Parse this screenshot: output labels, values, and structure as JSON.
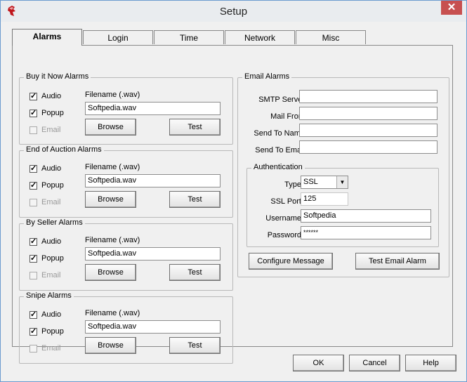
{
  "window": {
    "title": "Setup",
    "close_glyph": "✕"
  },
  "tabs": [
    {
      "label": "Alarms",
      "active": true
    },
    {
      "label": "Login"
    },
    {
      "label": "Time"
    },
    {
      "label": "Network"
    },
    {
      "label": "Misc"
    }
  ],
  "alarm_groups": [
    {
      "title": "Buy it Now Alarms",
      "audio": "Audio",
      "popup": "Popup",
      "email": "Email",
      "filename_label": "Filename (.wav)",
      "filename": "Softpedia.wav",
      "browse": "Browse",
      "test": "Test"
    },
    {
      "title": "End of Auction Alarms",
      "audio": "Audio",
      "popup": "Popup",
      "email": "Email",
      "filename_label": "Filename (.wav)",
      "filename": "Softpedia.wav",
      "browse": "Browse",
      "test": "Test"
    },
    {
      "title": "By Seller Alarms",
      "audio": "Audio",
      "popup": "Popup",
      "email": "Email",
      "filename_label": "Filename (.wav)",
      "filename": "Softpedia.wav",
      "browse": "Browse",
      "test": "Test"
    },
    {
      "title": "Snipe Alarms",
      "audio": "Audio",
      "popup": "Popup",
      "email": "Email",
      "filename_label": "Filename (.wav)",
      "filename": "Softpedia.wav",
      "browse": "Browse",
      "test": "Test"
    }
  ],
  "check_glyph": "✓",
  "email_alarms": {
    "title": "Email Alarms",
    "smtp_server_label": "SMTP Server",
    "smtp_server": "",
    "mail_from_label": "Mail From",
    "mail_from": "",
    "send_to_name_label": "Send To Name",
    "send_to_name": "",
    "send_to_email_label": "Send To Email",
    "send_to_email": "",
    "authentication": {
      "title": "Authentication",
      "type_label": "Type",
      "type_value": "SSL",
      "ssl_port_label": "SSL Port",
      "ssl_port": "125",
      "username_label": "Username",
      "username": "Softpedia",
      "password_label": "Password",
      "password": "******"
    },
    "configure_message": "Configure Message",
    "test_email_alarm": "Test Email Alarm"
  },
  "footer": {
    "ok": "OK",
    "cancel": "Cancel",
    "help": "Help"
  }
}
